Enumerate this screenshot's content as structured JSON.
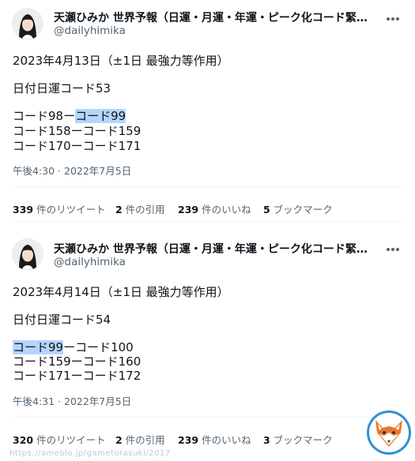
{
  "tweets": [
    {
      "author_name": "天瀬ひみか 世界予報（日運・月運・年運・ピーク化コード緊急警...",
      "author_handle": "@dailyhimika",
      "lines": {
        "l1": "2023年4月13日（±1日 最強力等作用）",
        "l2": "日付日運コード53",
        "l3_a": "コード98ー",
        "l3_b": "コード99",
        "l4": "コード158ーコード159",
        "l5": "コード170ーコード171"
      },
      "timestamp": "午後4:30 · 2022年7月5日",
      "stats": {
        "retweets_count": "339",
        "retweets_label": " 件のリツイート",
        "quotes_count": "2",
        "quotes_label": " 件の引用",
        "likes_count": "239",
        "likes_label": " 件のいいね",
        "bookmarks_count": "5",
        "bookmarks_label": " ブックマーク"
      }
    },
    {
      "author_name": "天瀬ひみか 世界予報（日運・月運・年運・ピーク化コード緊急警...",
      "author_handle": "@dailyhimika",
      "lines": {
        "l1": "2023年4月14日（±1日 最強力等作用）",
        "l2": "日付日運コード54",
        "l3_a": "コード99",
        "l3_b": "ーコード100",
        "l4": "コード159ーコード160",
        "l5": "コード171ーコード172"
      },
      "timestamp": "午後4:31 · 2022年7月5日",
      "stats": {
        "retweets_count": "320",
        "retweets_label": " 件のリツイート",
        "quotes_count": "2",
        "quotes_label": " 件の引用",
        "likes_count": "239",
        "likes_label": " 件のいいね",
        "bookmarks_count": "3",
        "bookmarks_label": " ブックマーク"
      }
    }
  ],
  "watermark": "https://ameblo.jp/gametorasuki/2017",
  "colors": {
    "highlight": "#b4d5fe",
    "secondary_text": "#536471",
    "logo_orange": "#e8772e",
    "logo_blue": "#2f8fd6"
  },
  "icons": [
    "more-icon",
    "fox-logo"
  ]
}
